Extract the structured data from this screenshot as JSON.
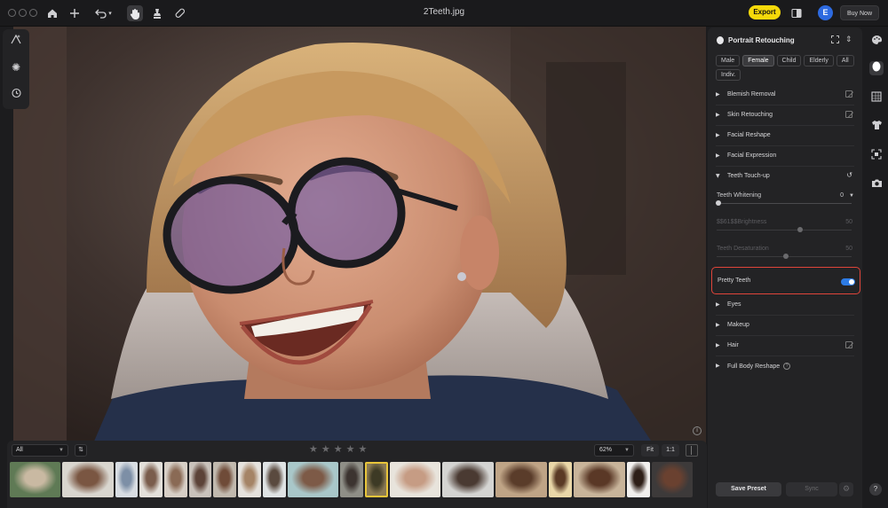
{
  "window": {
    "title": "2Teeth.jpg"
  },
  "toolbar": {
    "export_label": "Export",
    "avatar_letter": "E",
    "buy_label": "Buy Now"
  },
  "filmstrip": {
    "filter_value": "All",
    "zoom_value": "62%",
    "fit_label": "Fit",
    "one_to_one_label": "1:1",
    "rating_stars": 5,
    "thumbnails": [
      {
        "w": 57,
        "c1": "#5f7a55",
        "c2": "#c9b9a2"
      },
      {
        "w": 58,
        "c1": "#d9d6cf",
        "c2": "#7a5642"
      },
      {
        "w": 25,
        "c1": "#d8dde2",
        "c2": "#7d8fa6"
      },
      {
        "w": 26,
        "c1": "#e3e0da",
        "c2": "#7a5d4c"
      },
      {
        "w": 26,
        "c1": "#d7cfc6",
        "c2": "#8a6a55"
      },
      {
        "w": 25,
        "c1": "#c9c2bb",
        "c2": "#5c4338"
      },
      {
        "w": 26,
        "c1": "#c1b9ae",
        "c2": "#6f4b38"
      },
      {
        "w": 26,
        "c1": "#e5e2dd",
        "c2": "#a58466"
      },
      {
        "w": 26,
        "c1": "#dfe3e4",
        "c2": "#5a4a3f"
      },
      {
        "w": 57,
        "c1": "#a9c7c9",
        "c2": "#7d5a47"
      },
      {
        "w": 26,
        "c1": "#8f8f87",
        "c2": "#3c3430"
      },
      {
        "w": 26,
        "c1": "#8a7a55",
        "c2": "#3d3a25"
      },
      {
        "w": 57,
        "c1": "#e8e4dc",
        "c2": "#c69c84"
      },
      {
        "w": 58,
        "c1": "#d4d4d2",
        "c2": "#4a3a32"
      },
      {
        "w": 58,
        "c1": "#bfa486",
        "c2": "#5a3c2a"
      },
      {
        "w": 26,
        "c1": "#e9d7a8",
        "c2": "#5a3a25"
      },
      {
        "w": 58,
        "c1": "#c8b49a",
        "c2": "#5a3826"
      },
      {
        "w": 26,
        "c1": "#f2f0ee",
        "c2": "#2e1f18"
      },
      {
        "w": 46,
        "c1": "#3d3a3a",
        "c2": "#6a4130"
      }
    ]
  },
  "panel": {
    "title": "Portrait Retouching",
    "tabs": [
      "Male",
      "Female",
      "Child",
      "Elderly",
      "All",
      "Indiv."
    ],
    "active_tab": "Female",
    "sections": {
      "blemish": "Blemish Removal",
      "skin": "Skin Retouching",
      "reshape": "Facial Reshape",
      "expression": "Facial Expression",
      "teeth": "Teeth Touch-up",
      "eyes": "Eyes",
      "makeup": "Makeup",
      "hair": "Hair",
      "body": "Full Body Reshape"
    },
    "sliders": {
      "whitening_label": "Teeth Whitening",
      "whitening_value": "0",
      "brightness_label": "$$61$$Brightness",
      "brightness_value": "50",
      "desaturation_label": "Teeth Desaturation",
      "desaturation_value": "50"
    },
    "pretty_teeth_label": "Pretty Teeth",
    "pretty_teeth_on": true,
    "save_preset_label": "Save Preset",
    "sync_label": "Sync"
  }
}
